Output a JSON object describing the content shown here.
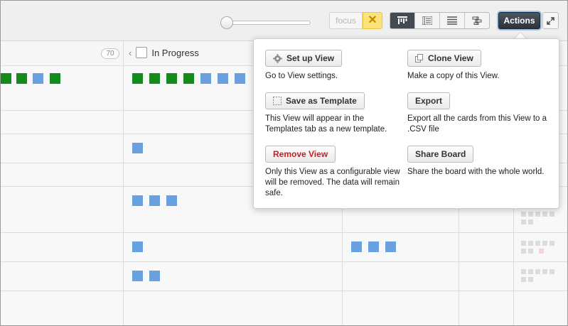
{
  "toolbar": {
    "focus_label": "focus",
    "focus_close_glyph": "✕",
    "actions_label": "Actions",
    "view_modes": [
      {
        "name": "board-view-icon",
        "active": true
      },
      {
        "name": "list-view-icon",
        "active": false
      },
      {
        "name": "table-view-icon",
        "active": false
      },
      {
        "name": "timeline-view-icon",
        "active": false
      }
    ]
  },
  "board": {
    "columns": [
      {
        "count": "70"
      },
      {
        "title": "In Progress"
      }
    ]
  },
  "actions_menu": {
    "items": [
      {
        "label": "Set up View",
        "icon": "gear-icon",
        "description": "Go to View settings."
      },
      {
        "label": "Clone View",
        "icon": "clone-icon",
        "description": "Make a copy of this View."
      },
      {
        "label": "Save as Template",
        "icon": "template-icon",
        "description": "This View will appear in the Templates tab as a new template."
      },
      {
        "label": "Export",
        "icon": "",
        "description": "Export all the cards from this View to a .CSV file"
      },
      {
        "label": "Remove View",
        "icon": "",
        "description": "Only this View as a configurable view will be removed. The data will remain safe."
      },
      {
        "label": "Share Board",
        "icon": "",
        "description": "Share the board with the whole world."
      }
    ]
  },
  "colors": {
    "card_green": "#138a1b",
    "card_blue": "#6aa0e0",
    "accent_yellow": "#fbe37a",
    "danger_red": "#c52020"
  }
}
